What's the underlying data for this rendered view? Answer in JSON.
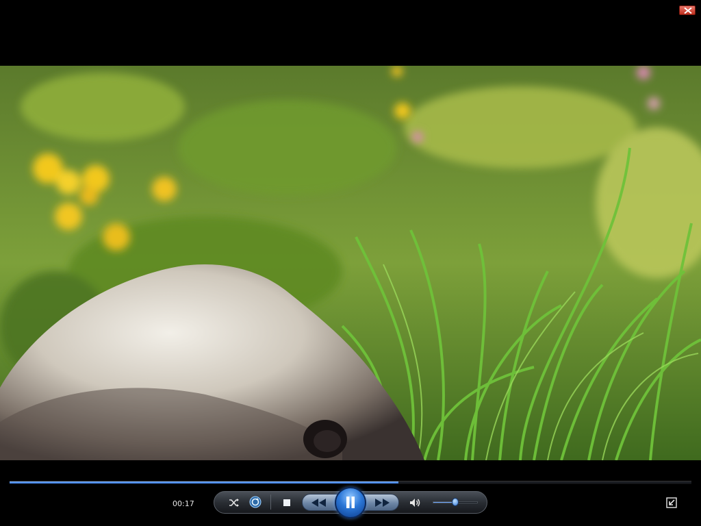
{
  "window": {
    "close_icon": "close-icon"
  },
  "video": {
    "subject": "video-frame"
  },
  "playback": {
    "position_fraction": 0.57,
    "current_time": "00:17",
    "state": "playing"
  },
  "controls": {
    "shuffle_icon": "shuffle-icon",
    "repeat_icon": "repeat-icon",
    "stop_icon": "stop-icon",
    "previous_icon": "rewind-icon",
    "play_pause_icon": "pause-icon",
    "next_icon": "fast-forward-icon",
    "mute_icon": "speaker-icon",
    "volume_fraction": 0.5,
    "fullscreen_icon": "exit-fullscreen-icon"
  },
  "colors": {
    "accent": "#2b76d6",
    "background": "#000000"
  }
}
